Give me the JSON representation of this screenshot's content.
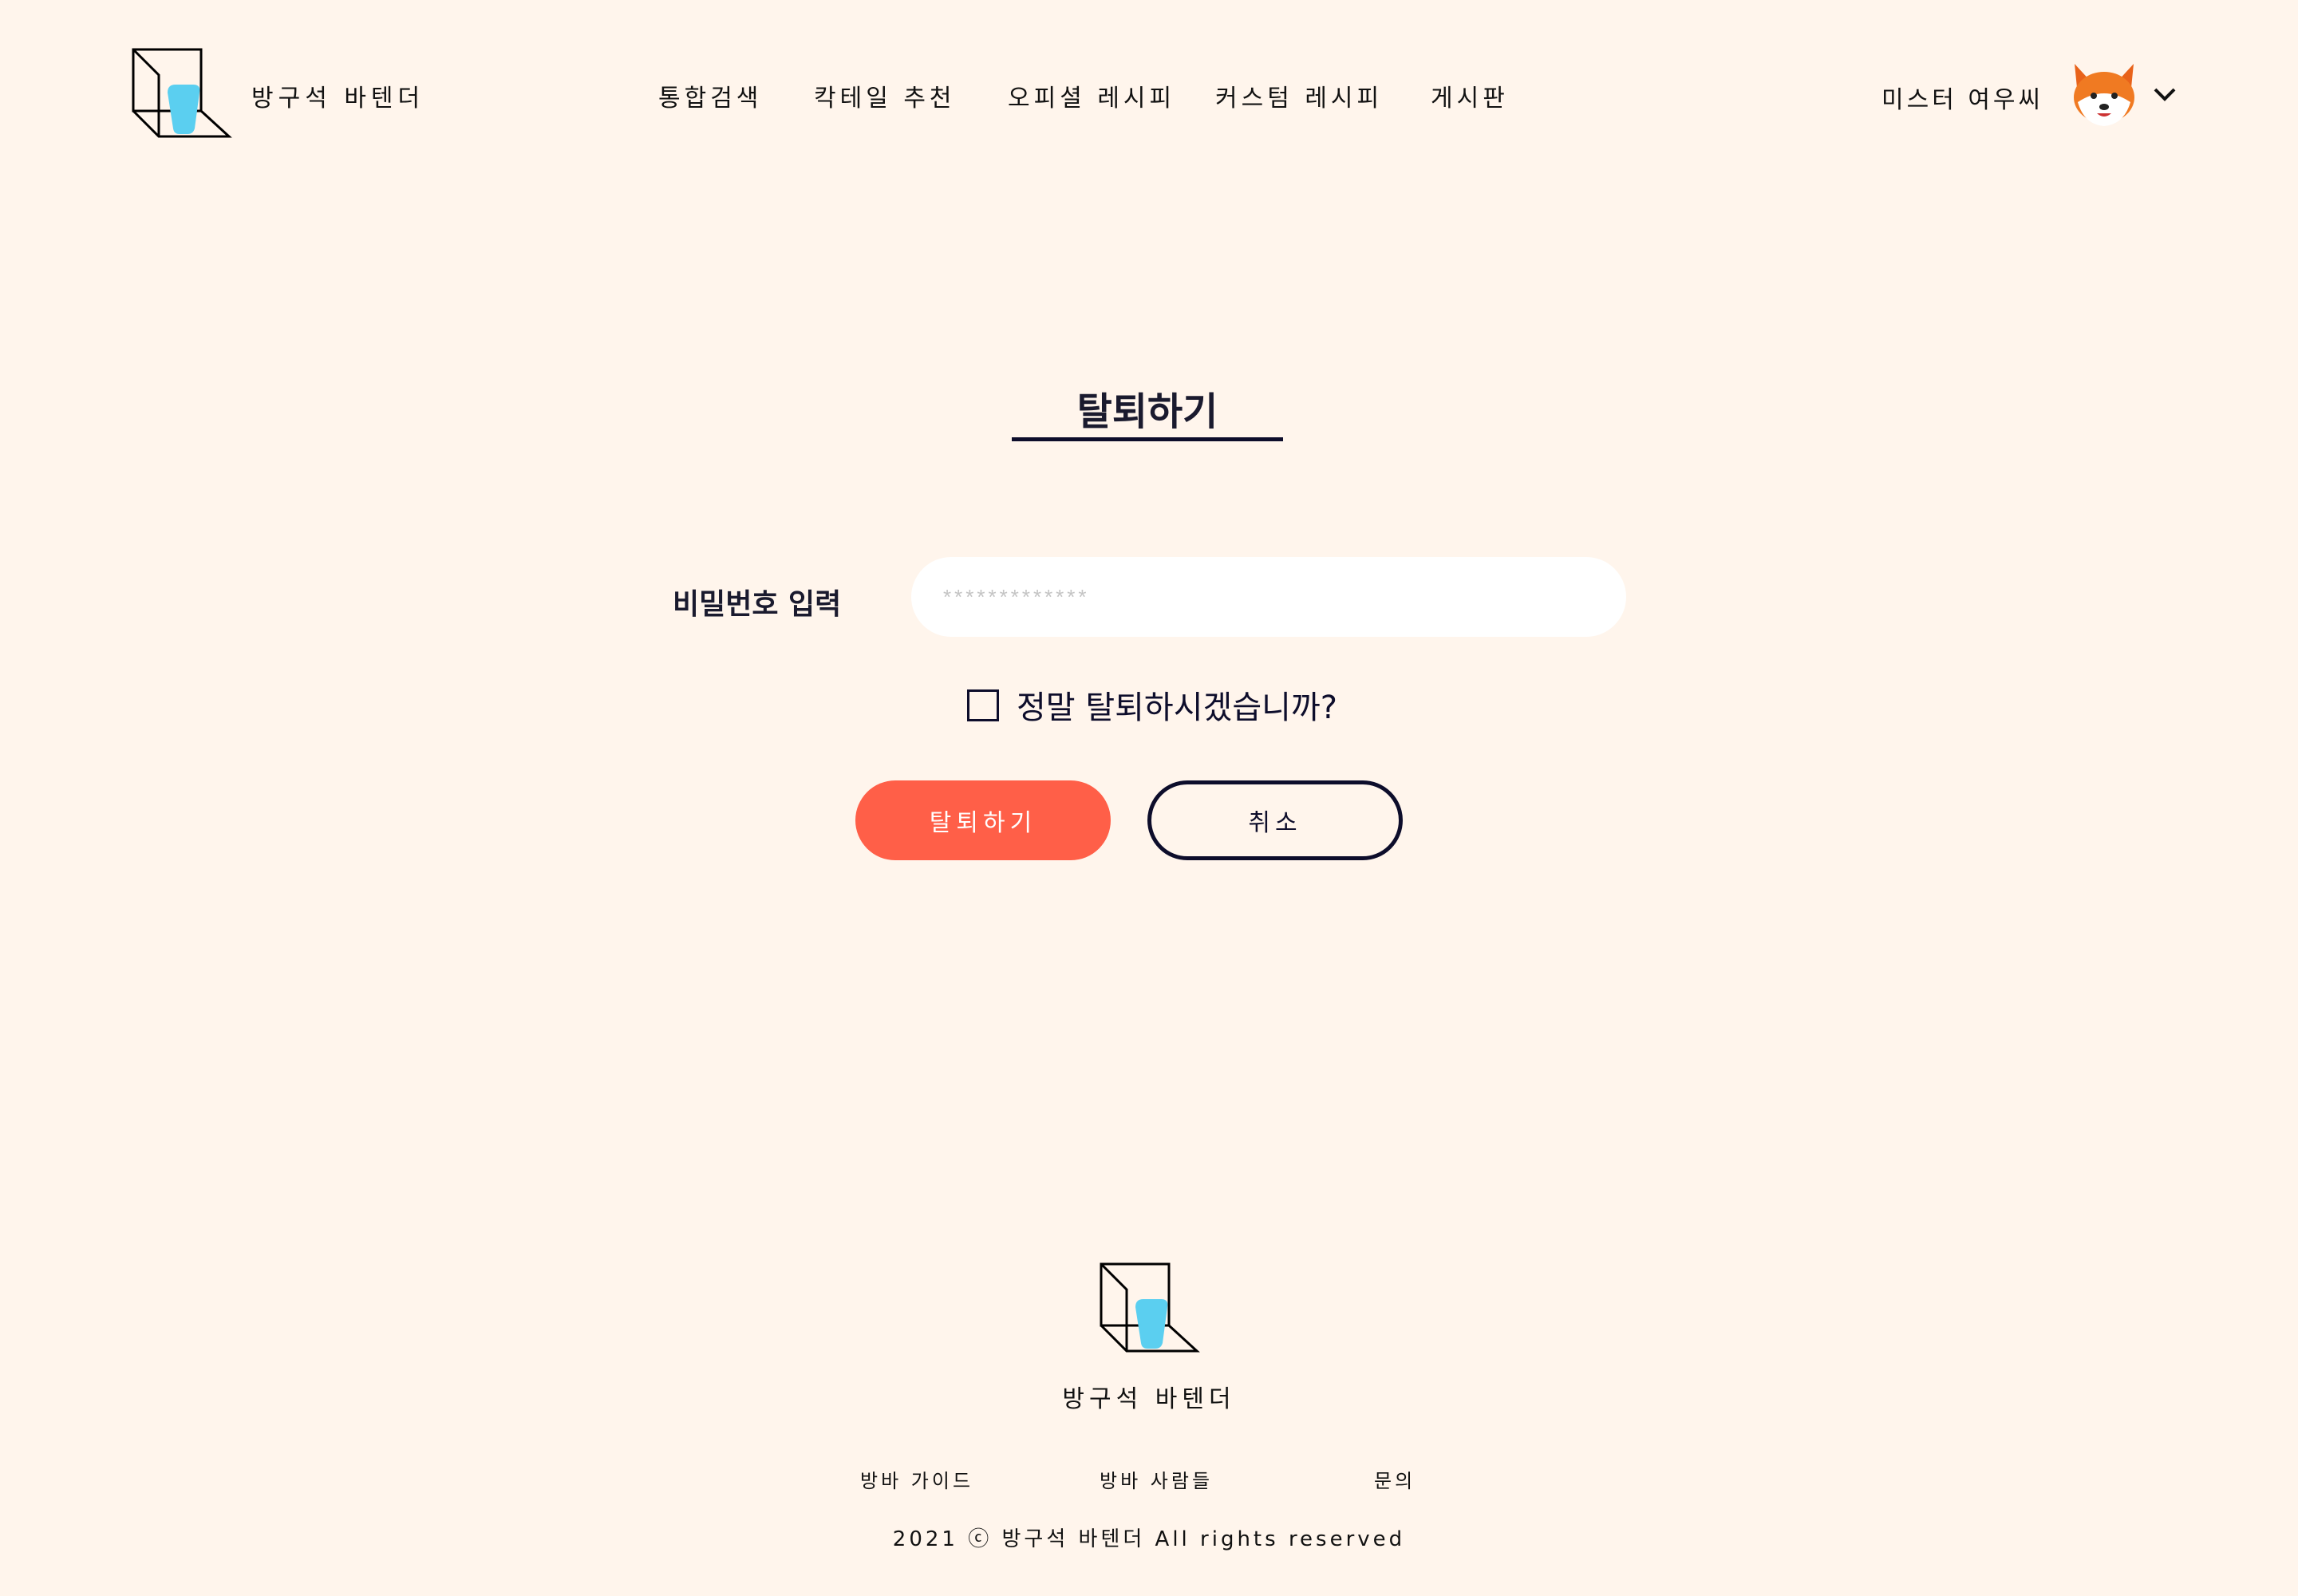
{
  "header": {
    "brand": "방구석 바텐더",
    "nav": [
      "통합검색",
      "칵테일 추천",
      "오피셜 레시피",
      "커스텀 레시피",
      "게시판"
    ],
    "user_name": "미스터 여우씨",
    "avatar_icon": "fox-emoji",
    "avatar_glyph": "🦊"
  },
  "main": {
    "title": "탈퇴하기",
    "password_label": "비밀번호 입력",
    "password_placeholder": "*************",
    "confirm_label": "정말 탈퇴하시겠습니까?",
    "confirm_checked": false,
    "withdraw_button": "탈퇴하기",
    "cancel_button": "취소"
  },
  "footer": {
    "brand": "방구석 바텐더",
    "links": [
      "방바 가이드",
      "방바 사람들",
      "문의"
    ],
    "copyright": "2021 ⓒ 방구석 바텐더 All rights reserved"
  },
  "colors": {
    "background": "#fff5ec",
    "accent": "#ff5f48",
    "navy": "#0d0d2b",
    "glass": "#5bcff0"
  }
}
